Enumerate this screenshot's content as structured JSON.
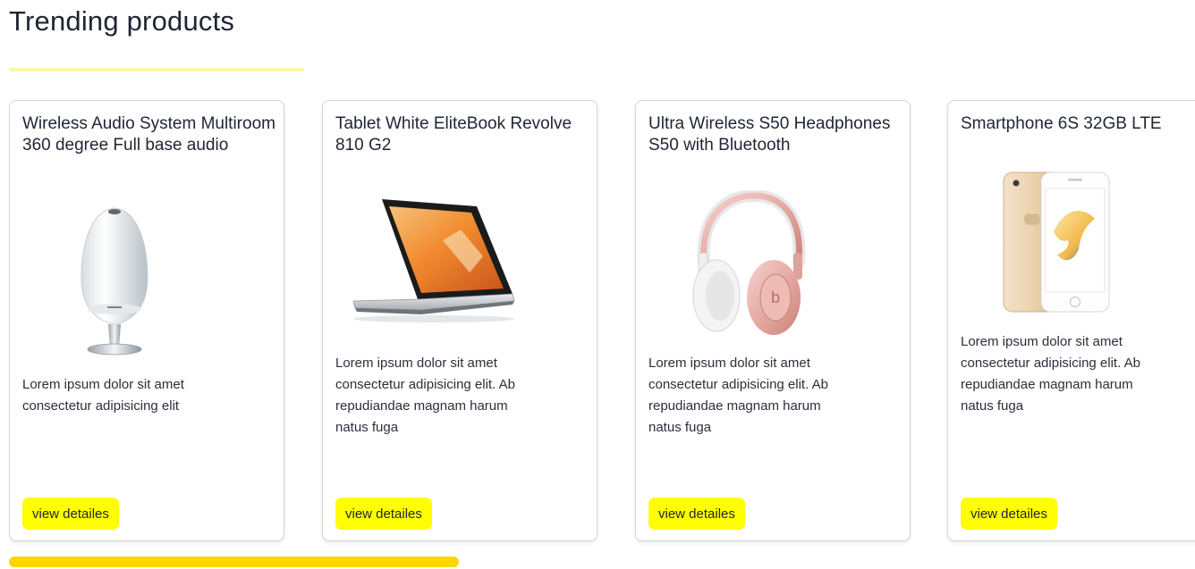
{
  "section": {
    "title": "Trending products"
  },
  "colors": {
    "accent_button": "#ffff00",
    "scroll_thumb": "#fdd600",
    "title_underline": "#fff3b0"
  },
  "products": [
    {
      "title": "Wireless Audio System Multiroom 360 degree Full base audio",
      "image_icon": "speaker-image",
      "description": "Lorem ipsum dolor sit amet consectetur adipisicing elit",
      "button_label": "view detailes"
    },
    {
      "title": "Tablet White EliteBook Revolve 810 G2",
      "image_icon": "laptop-image",
      "description": "Lorem ipsum dolor sit amet consectetur adipisicing elit. Ab repudiandae magnam harum natus fuga",
      "button_label": "view detailes"
    },
    {
      "title": "Ultra Wireless S50 Headphones S50 with Bluetooth",
      "image_icon": "headphones-image",
      "description": "Lorem ipsum dolor sit amet consectetur adipisicing elit. Ab repudiandae magnam harum natus fuga",
      "button_label": "view detailes"
    },
    {
      "title": "Smartphone 6S 32GB LTE",
      "image_icon": "smartphone-image",
      "description": "Lorem ipsum dolor sit amet consectetur adipisicing elit. Ab repudiandae magnam harum natus fuga",
      "button_label": "view detailes"
    }
  ]
}
